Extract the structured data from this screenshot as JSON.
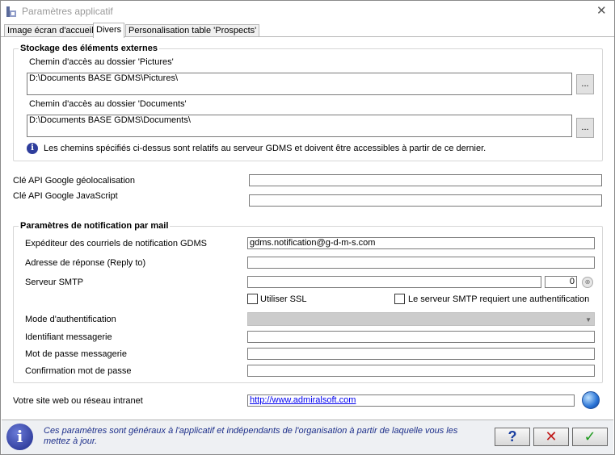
{
  "window": {
    "title": "Paramètres applicatif",
    "close_label": "✕"
  },
  "tabs": [
    {
      "label": "Image écran d'accueil",
      "active": false
    },
    {
      "label": "Divers",
      "active": true
    },
    {
      "label": "Personalisation table 'Prospects'",
      "active": false
    }
  ],
  "storage": {
    "legend": "Stockage des éléments externes",
    "pictures_label": "Chemin d'accès au dossier 'Pictures'",
    "pictures_value": "D:\\Documents BASE GDMS\\Pictures\\",
    "documents_label": "Chemin d'accès au dossier 'Documents'",
    "documents_value": "D:\\Documents BASE GDMS\\Documents\\",
    "browse_label": "...",
    "info_text": "Les chemins spécifiés ci-dessus sont relatifs au serveur GDMS et doivent être accessibles à partir de ce dernier."
  },
  "google": {
    "geo_label": "Clé API Google géolocalisation",
    "geo_value": "",
    "js_label": "Clé API Google JavaScript",
    "js_value": ""
  },
  "mail": {
    "legend": "Paramètres de notification par mail",
    "sender_label": "Expéditeur des courriels de notification GDMS",
    "sender_value": "gdms.notification@g-d-m-s.com",
    "reply_label": "Adresse de réponse (Reply to)",
    "reply_value": "",
    "smtp_label": "Serveur SMTP",
    "smtp_value": "",
    "port_value": "0",
    "ssl_label": "Utiliser SSL",
    "ssl_checked": false,
    "auth_required_label": "Le serveur SMTP requiert une authentification",
    "auth_required_checked": false,
    "auth_mode_label": "Mode d'authentification",
    "auth_mode_value": "",
    "login_label": "Identifiant messagerie",
    "login_value": "",
    "password_label": "Mot de passe messagerie",
    "password_value": "",
    "confirm_label": "Confirmation mot de passe",
    "confirm_value": ""
  },
  "website": {
    "label": "Votre site web ou réseau intranet",
    "value": "http://www.admiralsoft.com"
  },
  "footer": {
    "text": "Ces paramètres sont généraux à l'applicatif et indépendants de l'organisation à partir de laquelle vous les mettez à jour.",
    "help_label": "?",
    "cancel_label": "✕",
    "ok_label": "✓",
    "help_color": "#1a3fa0",
    "cancel_color": "#c01818",
    "ok_color": "#1e9a1e"
  }
}
